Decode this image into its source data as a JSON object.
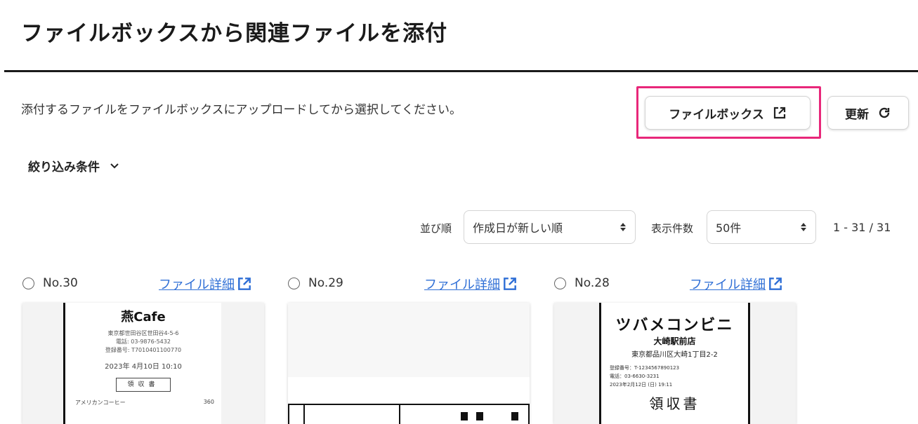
{
  "page": {
    "title": "ファイルボックスから関連ファイルを添付",
    "instruction": "添付するファイルをファイルボックスにアップロードしてから選択してください。"
  },
  "toolbar": {
    "filebox_label": "ファイルボックス",
    "refresh_label": "更新"
  },
  "filter": {
    "label": "絞り込み条件"
  },
  "sort": {
    "label": "並び順",
    "value": "作成日が新しい順",
    "count_label": "表示件数",
    "count_value": "50件",
    "range": "1 - 31 / 31"
  },
  "files": [
    {
      "number": "No.30",
      "detail_label": "ファイル詳細",
      "receipt": {
        "shop": "燕Cafe",
        "address": "東京都世田谷区世田谷4-5-6",
        "phone": "電話: 03-9876-5432",
        "reg": "登録番号: T7010401100770",
        "date": "2023年 4月10日 10:10",
        "stamp": "領収書",
        "item": "アメリカンコーヒー",
        "price": "360"
      }
    },
    {
      "number": "No.29",
      "detail_label": "ファイル詳細"
    },
    {
      "number": "No.28",
      "detail_label": "ファイル詳細",
      "receipt": {
        "shop": "ツバメコンビニ",
        "branch": "大崎駅前店",
        "address": "東京都品川区大崎1丁目2-2",
        "reg": "登録番号：T-1234567890123",
        "phone": "電話：03-6630-3231",
        "date": "2023年2月12日 (日) 19:11",
        "title": "領収書"
      }
    }
  ],
  "colors": {
    "highlight": "#e8277a",
    "link": "#2f6fd6"
  },
  "icons": {
    "external": "external-link-icon",
    "refresh": "refresh-icon",
    "chevron": "chevron-down-icon",
    "updown": "select-arrows-icon"
  }
}
